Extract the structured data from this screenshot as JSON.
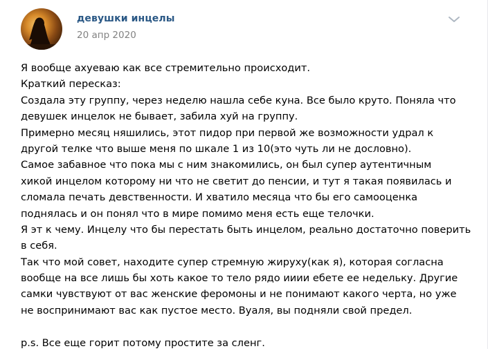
{
  "post": {
    "group_name": "девушки инцелы",
    "date": "20 апр 2020",
    "avatar_icon": "girl-silhouette-sunset-avatar",
    "menu_icon": "chevron-down-icon",
    "colors": {
      "link": "#2a5885",
      "meta": "#828282",
      "text": "#000000"
    },
    "lines": [
      "Я вообще ахуеваю как все стремительно происходит.",
      "Краткий пересказ:",
      "Создала эту группу, через неделю нашла себе куна. Все было круто. Поняла что",
      "девушек инцелок не бывает, забила хуй на группу.",
      "Примерно месяц няшились, этот пидор при первой же возможности удрал к",
      "другой телке что выше меня по шкале 1 из 10(это чуть ли не дословно).",
      "Самое забавное что пока мы с ним знакомились, он был супер аутентичным",
      "хикой инцелом которому ни что не светит до пенсии, и тут я такая появилась и",
      "сломала печать девственности. И хватило месяца что бы его самооценка",
      "поднялась и он понял что в мире помимо меня есть еще телочки.",
      "Я эт к чему. Инцелу что бы перестать быть инцелом, реально достаточно поверить",
      "в себя.",
      "Так что мой совет, находите супер стремную жируху(как я), которая согласна",
      "вообще на все лишь бы хоть какое то тело рядо ииии ебете ее недельку. Другие",
      "самки чувствуют от вас женские феромоны и не понимают какого черта, но уже",
      "не воспринимают вас как пустое место. Вуаля, вы подняли свой предел.",
      "",
      "p.s. Все еще горит потому простите за сленг."
    ]
  }
}
